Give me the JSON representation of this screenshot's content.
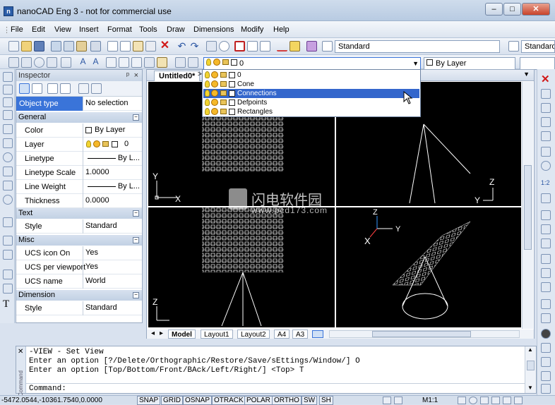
{
  "window": {
    "title": "nanoCAD Eng 3 - not for commercial use",
    "controls": [
      "–",
      "□",
      "✕"
    ]
  },
  "menu": [
    "File",
    "Edit",
    "View",
    "Insert",
    "Format",
    "Tools",
    "Draw",
    "Dimensions",
    "Modify",
    "Help"
  ],
  "toolbar": {
    "text_style": "Standard",
    "dim_style": "Standard",
    "current_layer": "0",
    "color": "By Layer"
  },
  "inspector": {
    "title": "Inspector",
    "pin": "ᵖ",
    "close": "×",
    "object_type_label": "Object type",
    "object_type_value": "No selection",
    "categories": {
      "general": "General",
      "text": "Text",
      "misc": "Misc",
      "dimension": "Dimension"
    },
    "general": [
      {
        "name": "Color",
        "value": "By Layer"
      },
      {
        "name": "Layer",
        "value": "0"
      },
      {
        "name": "Linetype",
        "value": "By L..."
      },
      {
        "name": "Linetype Scale",
        "value": "1.0000"
      },
      {
        "name": "Line Weight",
        "value": "By L..."
      },
      {
        "name": "Thickness",
        "value": "0.0000"
      }
    ],
    "text": [
      {
        "name": "Style",
        "value": "Standard"
      }
    ],
    "misc": [
      {
        "name": "UCS icon On",
        "value": "Yes"
      },
      {
        "name": "UCS per viewport",
        "value": "Yes"
      },
      {
        "name": "UCS name",
        "value": "World"
      }
    ],
    "dimension": [
      {
        "name": "Style",
        "value": "Standard"
      }
    ]
  },
  "document": {
    "tab": "Untitled0*",
    "layout_tabs": [
      "Model",
      "Layout1",
      "Layout2",
      "A4",
      "A3"
    ]
  },
  "layers": [
    "0",
    "Cone",
    "Connections",
    "Defpoints",
    "Rectangles"
  ],
  "layer_selected": "Connections",
  "watermark": {
    "brand": "闪电软件园",
    "url": "www.pcd173.com"
  },
  "axis_labels": {
    "x": "X",
    "y": "Y",
    "z": "Z"
  },
  "command": {
    "lines": [
      "-VIEW - Set View",
      "Enter an option [?/Delete/Orthographic/Restore/Save/sEttings/Window/] O",
      "Enter an option [Top/Bottom/Front/BAck/Left/Right/] <Top> T"
    ],
    "prompt": "Command:",
    "side_label": "Command"
  },
  "status": {
    "coords": "-5472.0544,-10361.7540,0.0000",
    "modes": [
      "SNAP",
      "GRID",
      "OSNAP",
      "OTRACK",
      "POLAR",
      "ORTHO",
      "SW",
      "SH"
    ],
    "scale": "M1:1"
  },
  "colors": {
    "accent": "#3399ff",
    "selected": "#3366cc",
    "active_field": "#3a74d9"
  }
}
